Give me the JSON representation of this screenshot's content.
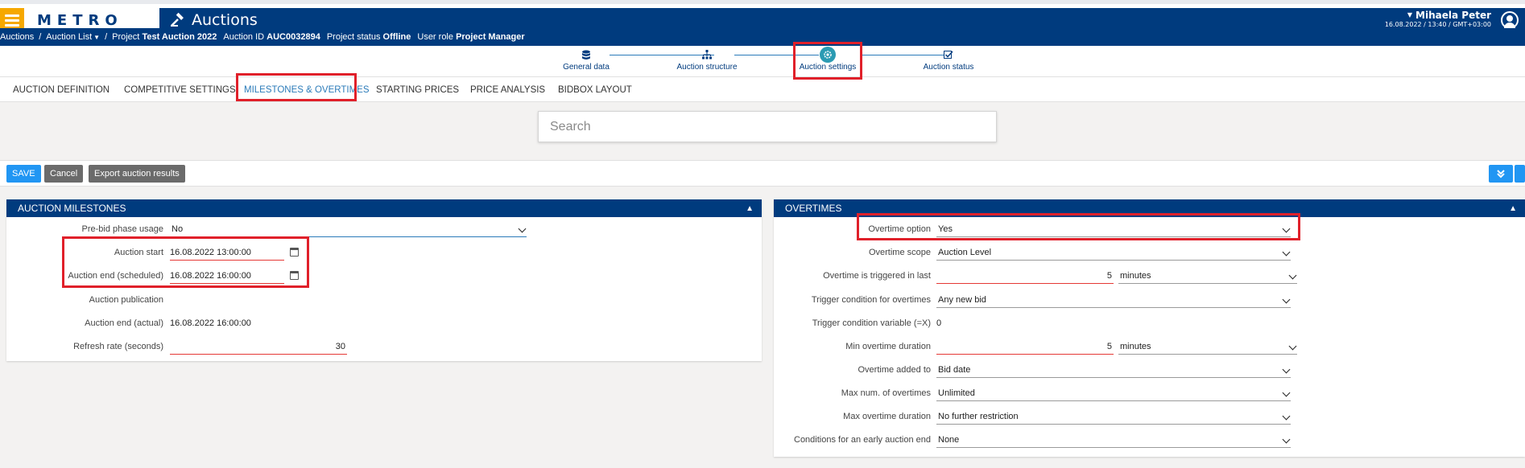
{
  "header": {
    "logo_text": "METRO",
    "app_title": "Auctions",
    "user_name": "Mihaela Peter",
    "user_datetime": "16.08.2022 / 13:40 / GMT+03:00"
  },
  "breadcrumb": {
    "root": "Auctions",
    "list": "Auction List",
    "project_label": "Project",
    "project_value": "Test Auction 2022",
    "auction_id_label": "Auction ID",
    "auction_id_value": "AUC0032894",
    "status_label": "Project status",
    "status_value": "Offline",
    "role_label": "User role",
    "role_value": "Project Manager"
  },
  "stepper": {
    "steps": [
      {
        "label": "General data",
        "icon": "database-icon"
      },
      {
        "label": "Auction structure",
        "icon": "hierarchy-icon"
      },
      {
        "label": "Auction settings",
        "icon": "gear-icon"
      },
      {
        "label": "Auction status",
        "icon": "checklist-icon"
      }
    ],
    "active_index": 2
  },
  "tabs": [
    {
      "label": "AUCTION DEFINITION"
    },
    {
      "label": "COMPETITIVE SETTINGS"
    },
    {
      "label": "MILESTONES & OVERTIMES"
    },
    {
      "label": "STARTING PRICES"
    },
    {
      "label": "PRICE ANALYSIS"
    },
    {
      "label": "BIDBOX LAYOUT"
    }
  ],
  "search": {
    "placeholder": "Search"
  },
  "actions": {
    "save": "SAVE",
    "cancel": "Cancel",
    "export": "Export auction results"
  },
  "milestones": {
    "title": "AUCTION MILESTONES",
    "prebid_label": "Pre-bid phase usage",
    "prebid_value": "No",
    "start_label": "Auction start",
    "start_value": "16.08.2022 13:00:00",
    "end_sched_label": "Auction end (scheduled)",
    "end_sched_value": "16.08.2022 16:00:00",
    "publication_label": "Auction publication",
    "end_actual_label": "Auction end (actual)",
    "end_actual_value": "16.08.2022 16:00:00",
    "refresh_label": "Refresh rate (seconds)",
    "refresh_value": "30"
  },
  "overtimes": {
    "title": "OVERTIMES",
    "option_label": "Overtime option",
    "option_value": "Yes",
    "scope_label": "Overtime scope",
    "scope_value": "Auction Level",
    "triggered_label": "Overtime is triggered in last",
    "triggered_value": "5",
    "triggered_unit": "minutes",
    "trigger_cond_label": "Trigger condition for overtimes",
    "trigger_cond_value": "Any new bid",
    "trigger_var_label": "Trigger condition variable (=X)",
    "trigger_var_value": "0",
    "min_dur_label": "Min overtime duration",
    "min_dur_value": "5",
    "min_dur_unit": "minutes",
    "added_to_label": "Overtime added to",
    "added_to_value": "Bid date",
    "max_num_label": "Max num. of overtimes",
    "max_num_value": "Unlimited",
    "max_dur_label": "Max overtime duration",
    "max_dur_value": "No further restriction",
    "early_end_label": "Conditions for an early auction end",
    "early_end_value": "None"
  },
  "colors": {
    "brand_blue": "#003b7e",
    "accent_yellow": "#f6a800",
    "highlight_red": "#e0202a",
    "button_blue": "#2196f3"
  }
}
